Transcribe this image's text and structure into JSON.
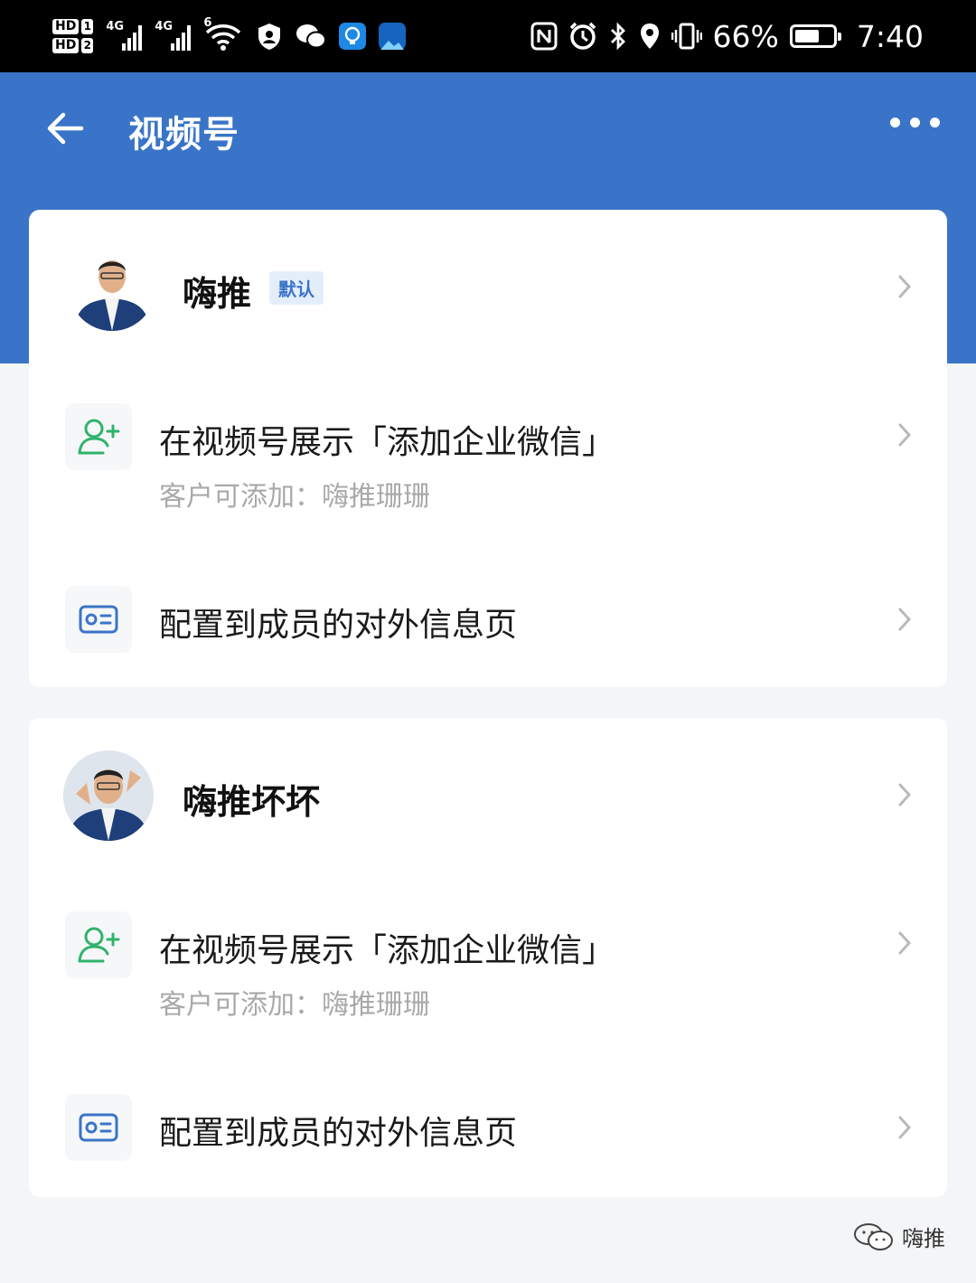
{
  "status_bar": {
    "hd_label": "HD",
    "sim1": "1",
    "sim2": "2",
    "network1": "4G",
    "network2": "4G",
    "wifi_label": "6",
    "battery_percent": "66%",
    "battery_level": 0.66,
    "time": "7:40",
    "icons": [
      "signal-icon",
      "wifi-icon",
      "vpn-shield-icon",
      "wechat-icon",
      "lightbulb-app-icon",
      "app-icon",
      "nfc-icon",
      "alarm-icon",
      "bluetooth-icon",
      "location-icon",
      "vibrate-icon",
      "battery-icon"
    ]
  },
  "header": {
    "title": "视频号",
    "back_icon": "arrow-left-icon",
    "more_icon": "more-horizontal-icon"
  },
  "accounts": [
    {
      "name": "嗨推",
      "badge": "默认",
      "show_item": {
        "title": "在视频号展示「添加企业微信」",
        "subtitle": "客户可添加：嗨推珊珊",
        "icon": "add-contact-icon"
      },
      "config_item": {
        "title": "配置到成员的对外信息页",
        "icon": "id-card-icon"
      }
    },
    {
      "name": "嗨推坏坏",
      "show_item": {
        "title": "在视频号展示「添加企业微信」",
        "subtitle": "客户可添加：嗨推珊珊",
        "icon": "add-contact-icon"
      },
      "config_item": {
        "title": "配置到成员的对外信息页",
        "icon": "id-card-icon"
      }
    }
  ],
  "watermark": {
    "text": "嗨推",
    "icon": "wechat-logo-icon"
  },
  "colors": {
    "primary": "#3a74c8",
    "green_icon": "#2fb36b",
    "blue_icon": "#3a74c8",
    "subtitle": "#a9a9a9",
    "background": "#f4f5f7"
  }
}
